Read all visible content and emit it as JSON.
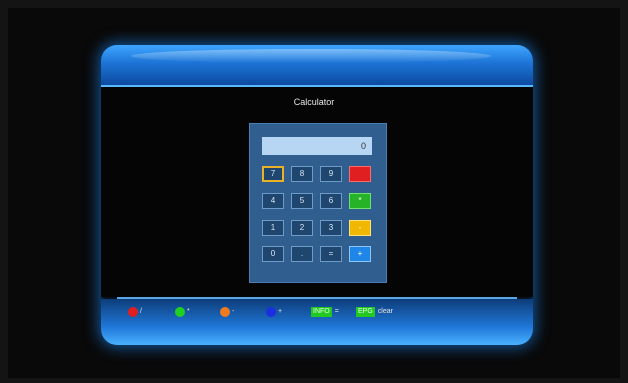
{
  "window": {
    "title": "Calculator"
  },
  "calculator": {
    "display": "0",
    "keys": [
      {
        "label": "7",
        "type": "digit",
        "selected": true
      },
      {
        "label": "8",
        "type": "digit"
      },
      {
        "label": "9",
        "type": "digit"
      },
      {
        "label": "",
        "type": "red"
      },
      {
        "label": "4",
        "type": "digit"
      },
      {
        "label": "5",
        "type": "digit"
      },
      {
        "label": "6",
        "type": "digit"
      },
      {
        "label": "*",
        "type": "green"
      },
      {
        "label": "1",
        "type": "digit"
      },
      {
        "label": "2",
        "type": "digit"
      },
      {
        "label": "3",
        "type": "digit"
      },
      {
        "label": "-",
        "type": "yellow"
      },
      {
        "label": "0",
        "type": "digit"
      },
      {
        "label": ".",
        "type": "digit"
      },
      {
        "label": "=",
        "type": "digit"
      },
      {
        "label": "+",
        "type": "blue"
      }
    ]
  },
  "footer": {
    "items": [
      {
        "color": "#e02020",
        "label": "/"
      },
      {
        "color": "#22d022",
        "label": "*"
      },
      {
        "color": "#f07a20",
        "label": "-"
      },
      {
        "color": "#1a2fe0",
        "label": "+"
      }
    ],
    "info": {
      "tag": "INFO",
      "label": "="
    },
    "epg": {
      "tag": "EPG",
      "label": "clear"
    }
  }
}
